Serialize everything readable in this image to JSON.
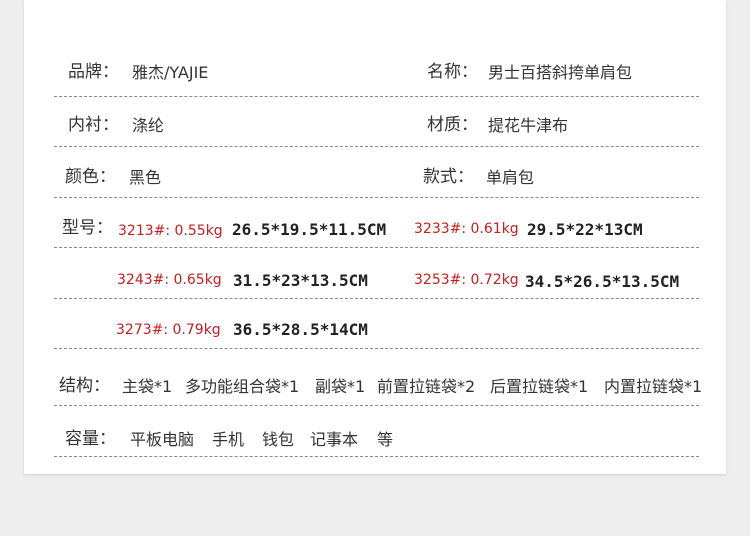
{
  "rows": {
    "brand": {
      "label": "品牌：",
      "value": "雅杰/YAJIE"
    },
    "name": {
      "label": "名称：",
      "value": "男士百搭斜挎单肩包"
    },
    "lining": {
      "label": "内衬：",
      "value": "涤纶"
    },
    "material": {
      "label": "材质：",
      "value": "提花牛津布"
    },
    "color": {
      "label": "颜色：",
      "value": "黑色"
    },
    "style": {
      "label": "款式：",
      "value": "单肩包"
    },
    "model": {
      "label": "型号：",
      "items": [
        {
          "code": "3213#: 0.55kg",
          "size": "26.5*19.5*11.5CM"
        },
        {
          "code": "3233#: 0.61kg",
          "size": "29.5*22*13CM"
        },
        {
          "code": "3243#: 0.65kg",
          "size": "31.5*23*13.5CM"
        },
        {
          "code": "3253#: 0.72kg",
          "size": "34.5*26.5*13.5CM"
        },
        {
          "code": "3273#: 0.79kg",
          "size": "36.5*28.5*14CM"
        }
      ]
    },
    "structure": {
      "label": "结构：",
      "items": [
        "主袋*1",
        "多功能组合袋*1",
        "副袋*1",
        "前置拉链袋*2",
        "后置拉链袋*1",
        "内置拉链袋*1"
      ]
    },
    "capacity": {
      "label": "容量：",
      "items": [
        "平板电脑",
        "手机",
        "钱包",
        "记事本",
        "等"
      ]
    }
  }
}
